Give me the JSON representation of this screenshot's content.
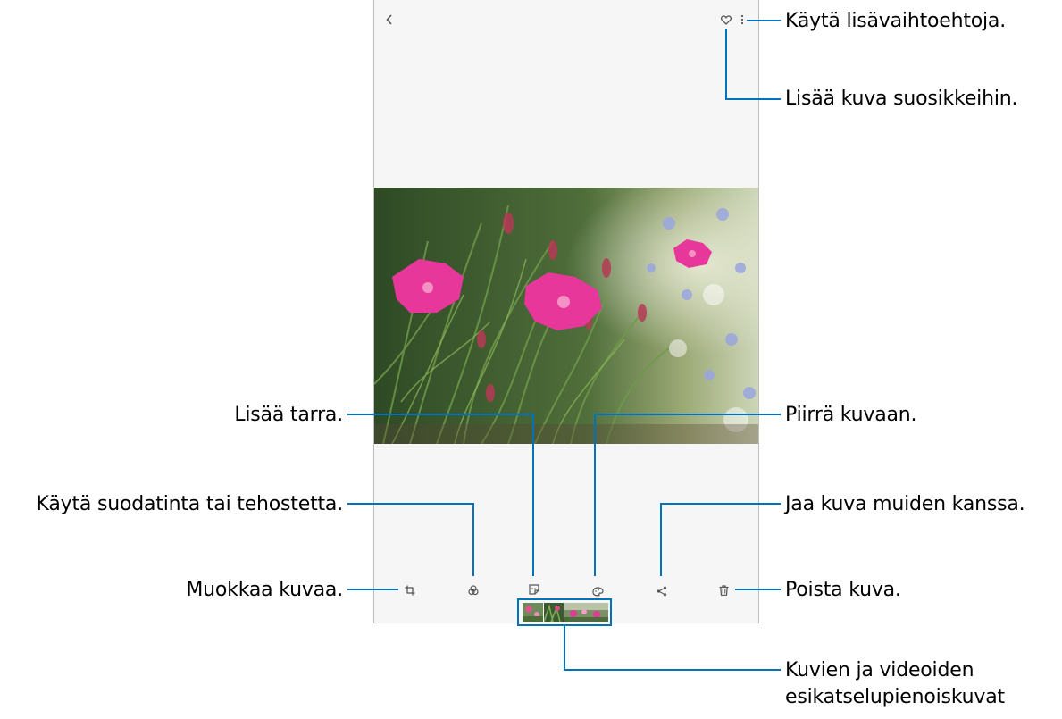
{
  "annotations": {
    "more_options": "Käytä lisävaihtoehtoja.",
    "add_favorite": "Lisää kuva suosikkeihin.",
    "add_sticker": "Lisää tarra.",
    "draw": "Piirrä kuvaan.",
    "filter": "Käytä suodatinta tai tehostetta.",
    "share": "Jaa kuva muiden kanssa.",
    "edit": "Muokkaa kuvaa.",
    "delete": "Poista kuva.",
    "thumbnails_line1": "Kuvien ja videoiden",
    "thumbnails_line2": "esikatselupienoiskuvat"
  },
  "icons": {
    "back": "back-arrow-icon",
    "favorite": "heart-icon",
    "more": "more-options-icon",
    "edit": "crop-edit-icon",
    "filter": "filter-icon",
    "sticker": "sticker-icon",
    "draw": "draw-icon",
    "share": "share-icon",
    "delete": "trash-icon"
  },
  "colors": {
    "callout_blue": "#0072bc",
    "screen_bg": "#f6f6f6",
    "icon_gray": "#555555"
  }
}
